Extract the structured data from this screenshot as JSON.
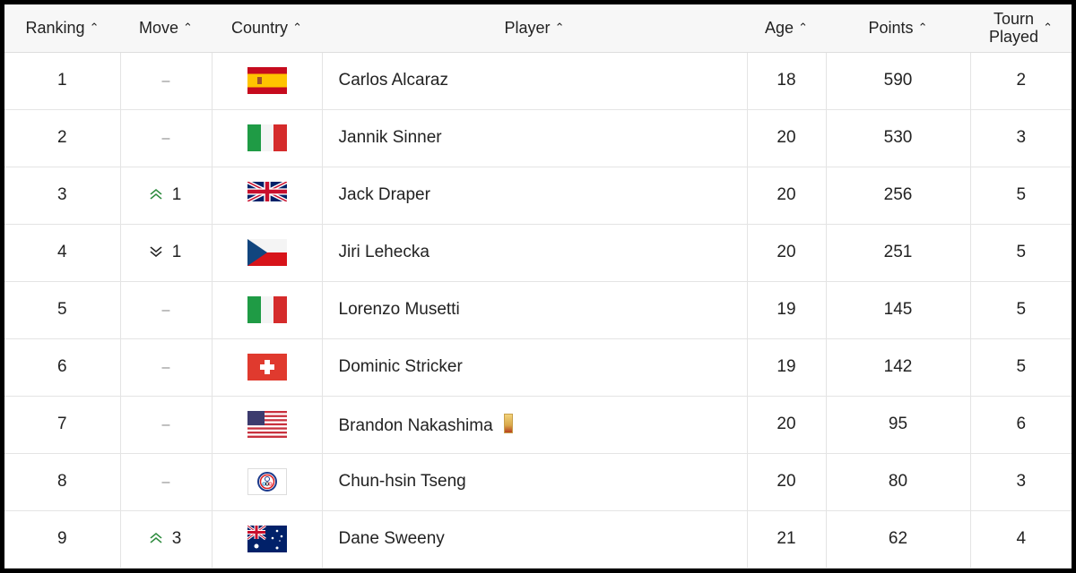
{
  "columns": {
    "ranking": "Ranking",
    "move": "Move",
    "country": "Country",
    "player": "Player",
    "age": "Age",
    "points": "Points",
    "tourn_line1": "Tourn",
    "tourn_line2": "Played",
    "sort_icon": "^"
  },
  "rows": [
    {
      "rank": "1",
      "move_dir": "none",
      "move": "–",
      "country": "Spain",
      "flag": "flag-spain-icon",
      "player": "Carlos Alcaraz",
      "age": "18",
      "points": "590",
      "played": "2"
    },
    {
      "rank": "2",
      "move_dir": "none",
      "move": "–",
      "country": "Italy",
      "flag": "flag-italy-icon",
      "player": "Jannik Sinner",
      "age": "20",
      "points": "530",
      "played": "3"
    },
    {
      "rank": "3",
      "move_dir": "up",
      "move": "1",
      "country": "Great Britain",
      "flag": "flag-uk-icon",
      "player": "Jack Draper",
      "age": "20",
      "points": "256",
      "played": "5"
    },
    {
      "rank": "4",
      "move_dir": "down",
      "move": "1",
      "country": "Czech Republic",
      "flag": "flag-czech-icon",
      "player": "Jiri Lehecka",
      "age": "20",
      "points": "251",
      "played": "5"
    },
    {
      "rank": "5",
      "move_dir": "none",
      "move": "–",
      "country": "Italy",
      "flag": "flag-italy-icon",
      "player": "Lorenzo Musetti",
      "age": "19",
      "points": "145",
      "played": "5"
    },
    {
      "rank": "6",
      "move_dir": "none",
      "move": "–",
      "country": "Switzerland",
      "flag": "flag-switzerland-icon",
      "player": "Dominic Stricker",
      "age": "19",
      "points": "142",
      "played": "5"
    },
    {
      "rank": "7",
      "move_dir": "none",
      "move": "–",
      "country": "USA",
      "flag": "flag-usa-icon",
      "player": "Brandon Nakashima",
      "badge": "qualified-badge-icon",
      "age": "20",
      "points": "95",
      "played": "6"
    },
    {
      "rank": "8",
      "move_dir": "none",
      "move": "–",
      "country": "Chinese Taipei",
      "flag": "flag-chinese-taipei-icon",
      "player": "Chun-hsin Tseng",
      "age": "20",
      "points": "80",
      "played": "3"
    },
    {
      "rank": "9",
      "move_dir": "up",
      "move": "3",
      "country": "Australia",
      "flag": "flag-australia-icon",
      "player": "Dane Sweeny",
      "age": "21",
      "points": "62",
      "played": "4"
    }
  ],
  "colors": {
    "move_up": "#2e8b3e",
    "move_down": "#222222",
    "header_bg": "#f7f7f7"
  }
}
